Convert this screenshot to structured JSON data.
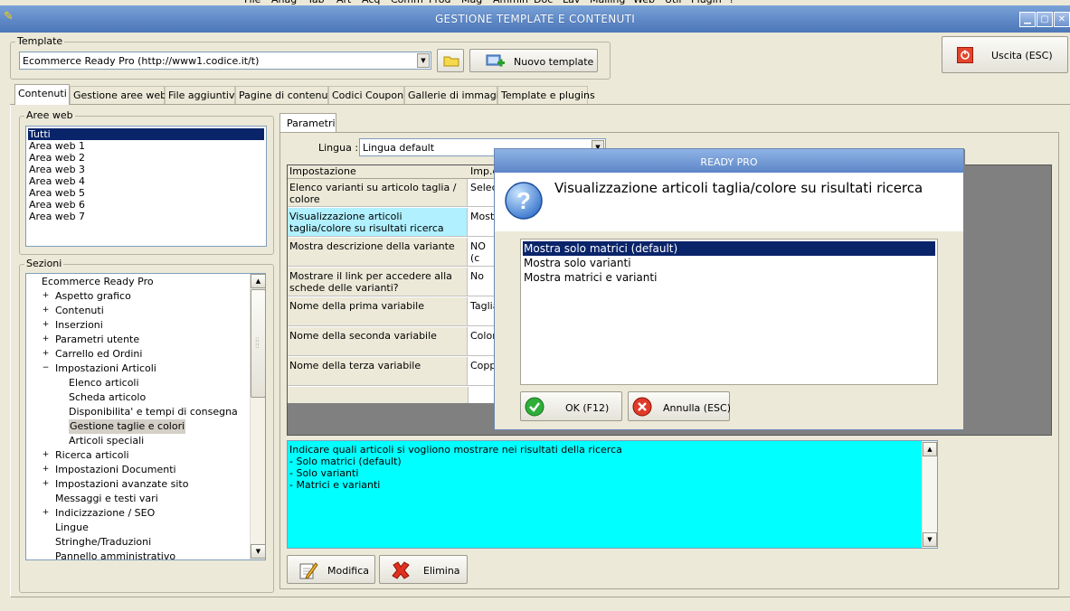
{
  "menubar": [
    "File",
    "Anag",
    "Tab",
    "Art",
    "Acq",
    "Comm",
    "Prod",
    "Mag",
    "Ammin",
    "Doc",
    "Lav",
    "Mailing",
    "Web",
    "Util",
    "Plugin",
    "?"
  ],
  "window": {
    "title": "GESTIONE TEMPLATE E CONTENUTI"
  },
  "template": {
    "group_label": "Template",
    "selected": "Ecommerce Ready Pro (http://www1.codice.it/t)",
    "new_button": "Nuovo template"
  },
  "exit_button": "Uscita (ESC)",
  "tabs": [
    "Contenuti",
    "Gestione aree web",
    "File aggiuntivi",
    "Pagine di contenuti",
    "Codici Coupon",
    "Gallerie di immagini",
    "Template e plugins"
  ],
  "aree_web": {
    "label": "Aree web",
    "items": [
      "Tutti",
      "Area web 1",
      "Area web 2",
      "Area web 3",
      "Area web 4",
      "Area web 5",
      "Area web 6",
      "Area web 7"
    ],
    "selected_index": 0
  },
  "sezioni": {
    "label": "Sezioni",
    "root": "Ecommerce Ready Pro",
    "items": [
      {
        "label": "Aspetto grafico",
        "level": 1,
        "expander": "+"
      },
      {
        "label": "Contenuti",
        "level": 1,
        "expander": "+"
      },
      {
        "label": "Inserzioni",
        "level": 1,
        "expander": "+"
      },
      {
        "label": "Parametri utente",
        "level": 1,
        "expander": "+"
      },
      {
        "label": "Carrello ed Ordini",
        "level": 1,
        "expander": "+"
      },
      {
        "label": "Impostazioni Articoli",
        "level": 1,
        "expander": "−"
      },
      {
        "label": "Elenco articoli",
        "level": 2,
        "expander": ""
      },
      {
        "label": "Scheda articolo",
        "level": 2,
        "expander": ""
      },
      {
        "label": "Disponibilita' e tempi di consegna",
        "level": 2,
        "expander": ""
      },
      {
        "label": "Gestione taglie e colori",
        "level": 2,
        "expander": "",
        "selected": true
      },
      {
        "label": "Articoli speciali",
        "level": 2,
        "expander": ""
      },
      {
        "label": "Ricerca articoli",
        "level": 1,
        "expander": "+"
      },
      {
        "label": "Impostazioni Documenti",
        "level": 1,
        "expander": "+"
      },
      {
        "label": "Impostazioni avanzate sito",
        "level": 1,
        "expander": "+"
      },
      {
        "label": "Messaggi e testi vari",
        "level": 1,
        "expander": ""
      },
      {
        "label": "Indicizzazione / SEO",
        "level": 1,
        "expander": "+"
      },
      {
        "label": "Lingue",
        "level": 1,
        "expander": ""
      },
      {
        "label": "Stringhe/Traduzioni",
        "level": 1,
        "expander": ""
      },
      {
        "label": "Pannello amministrativo",
        "level": 1,
        "expander": ""
      }
    ]
  },
  "params": {
    "tab": "Parametri",
    "lingua_label": "Lingua :",
    "lingua_value": "Lingua default",
    "columns": [
      "Impostazione",
      "Imp.c"
    ],
    "rows": [
      {
        "setting": "Elenco varianti su articolo taglia / colore",
        "value": "Selec"
      },
      {
        "setting": "Visualizzazione articoli taglia/colore su risultati ricerca",
        "value": "Mostr",
        "highlight": true
      },
      {
        "setting": "Mostra descrizione della variante",
        "value": "NO (c"
      },
      {
        "setting": "Mostrare il link per accedere alla schede delle varianti?",
        "value": "No"
      },
      {
        "setting": "Nome della prima variabile",
        "value": "Taglia"
      },
      {
        "setting": "Nome della seconda variabile",
        "value": "Color"
      },
      {
        "setting": "Nome della terza variabile",
        "value": "Copp"
      }
    ],
    "description": [
      "Indicare quali articoli si vogliono mostrare nei risultati della ricerca",
      "- Solo matrici (default)",
      "- Solo varianti",
      "- Matrici e varianti"
    ],
    "modify_button": "Modifica",
    "delete_button": "Elimina"
  },
  "dialog": {
    "title": "READY PRO",
    "question": "Visualizzazione articoli taglia/colore su risultati ricerca",
    "options": [
      "Mostra solo matrici (default)",
      "Mostra solo varianti",
      "Mostra matrici e varianti"
    ],
    "selected_index": 0,
    "ok_button": "OK (F12)",
    "cancel_button": "Annulla (ESC)"
  },
  "colors": {
    "selection": "#0a246a",
    "description_bg": "#00ffff",
    "highlight_cell": "#b0f0ff",
    "title_blue": "#5c86c4",
    "dark_gray": "#808080"
  }
}
